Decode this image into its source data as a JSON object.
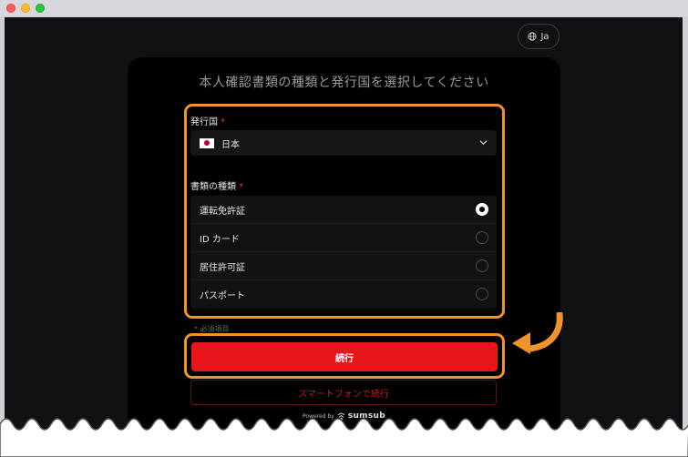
{
  "language": {
    "label": "Ja"
  },
  "card": {
    "title": "本人確認書類の種類と発行国を選択してください"
  },
  "country": {
    "label": "発行国",
    "required_mark": "*",
    "selected": "日本"
  },
  "document_type": {
    "label": "書類の種類",
    "required_mark": "*",
    "options": [
      {
        "label": "運転免許証",
        "checked": true
      },
      {
        "label": "ID カード",
        "checked": false
      },
      {
        "label": "居住許可証",
        "checked": false
      },
      {
        "label": "パスポート",
        "checked": false
      }
    ]
  },
  "required_note": "* 必須項目",
  "buttons": {
    "continue": "続行",
    "continue_on_phone": "スマートフォンで続行"
  },
  "footer": {
    "powered_by": "Powered by",
    "brand": "sumsub"
  },
  "colors": {
    "accent_red": "#e8151a",
    "highlight_orange": "#f0932b",
    "flag_red": "#bc002d"
  }
}
